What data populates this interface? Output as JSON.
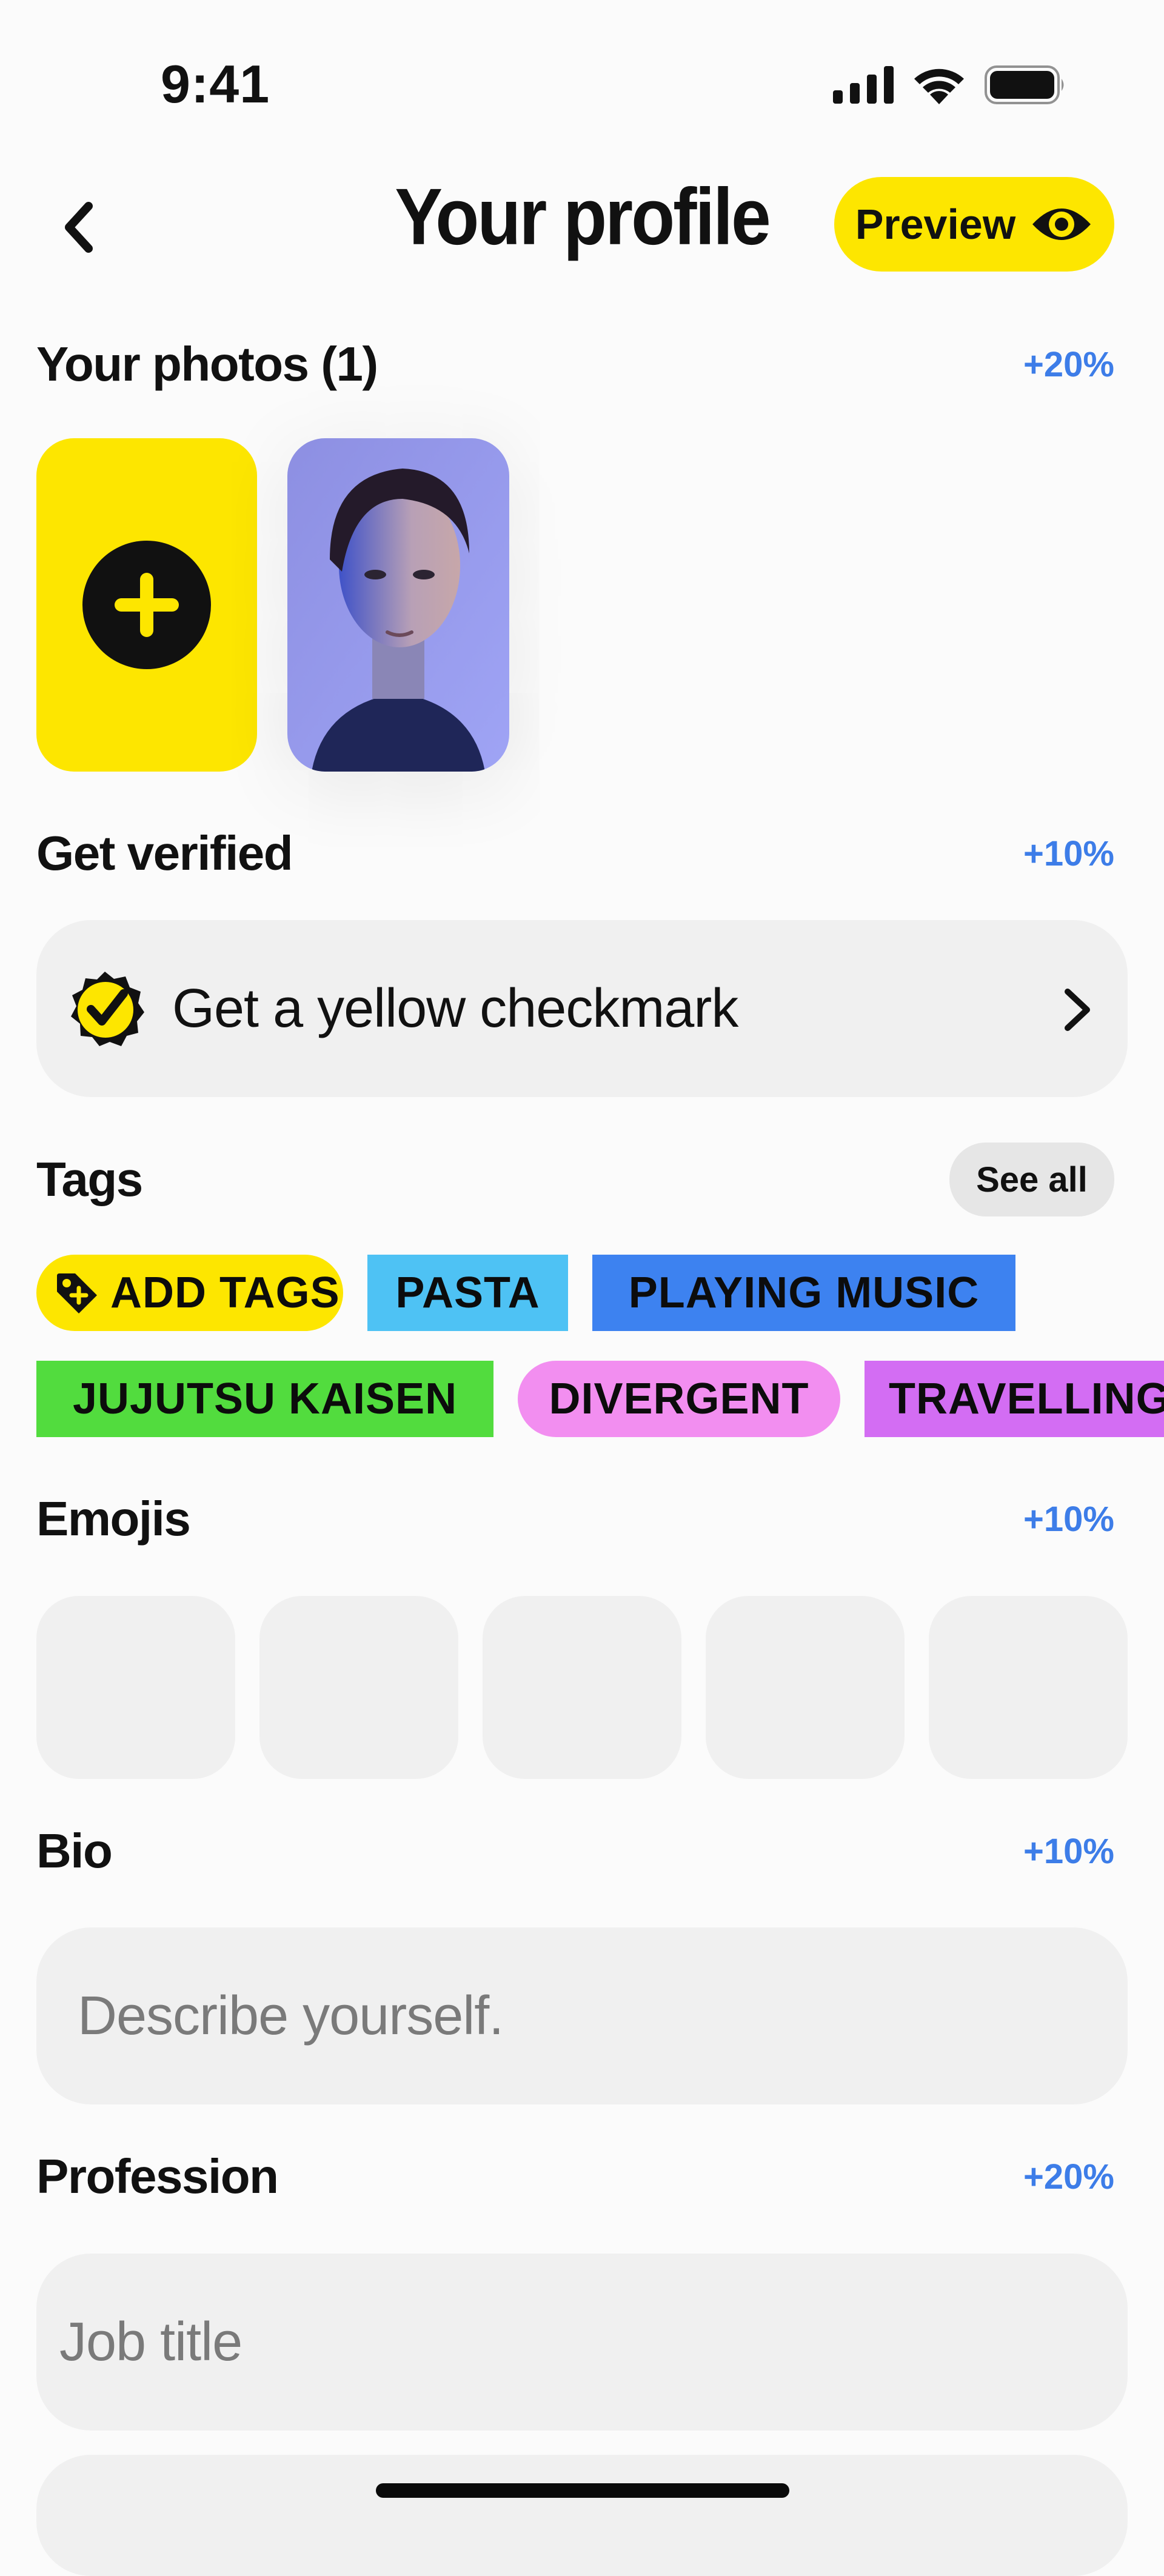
{
  "status_bar": {
    "time": "9:41"
  },
  "nav": {
    "title": "Your profile",
    "preview_label": "Preview"
  },
  "photos": {
    "title": "Your photos (1)",
    "bonus": "+20%"
  },
  "verified": {
    "title": "Get verified",
    "bonus": "+10%",
    "row_label": "Get a yellow checkmark"
  },
  "tags": {
    "title": "Tags",
    "see_all": "See all",
    "items": [
      {
        "label": "ADD TAGS",
        "color": "#fde600"
      },
      {
        "label": "PASTA",
        "color": "#4ec2f4"
      },
      {
        "label": "PLAYING MUSIC",
        "color": "#3d82f0"
      },
      {
        "label": "JUJUTSU KAISEN",
        "color": "#52dc3e"
      },
      {
        "label": "DIVERGENT",
        "color": "#f28ef0"
      },
      {
        "label": "TRAVELLING",
        "color": "#d36df3"
      }
    ]
  },
  "emojis": {
    "title": "Emojis",
    "bonus": "+10%"
  },
  "bio": {
    "title": "Bio",
    "bonus": "+10%",
    "placeholder": "Describe yourself."
  },
  "profession": {
    "title": "Profession",
    "bonus": "+20%",
    "placeholder": "Job title"
  },
  "colors": {
    "accent_yellow": "#fde600",
    "bonus_blue": "#3d7de8",
    "field_bg": "#f0f0f0"
  }
}
